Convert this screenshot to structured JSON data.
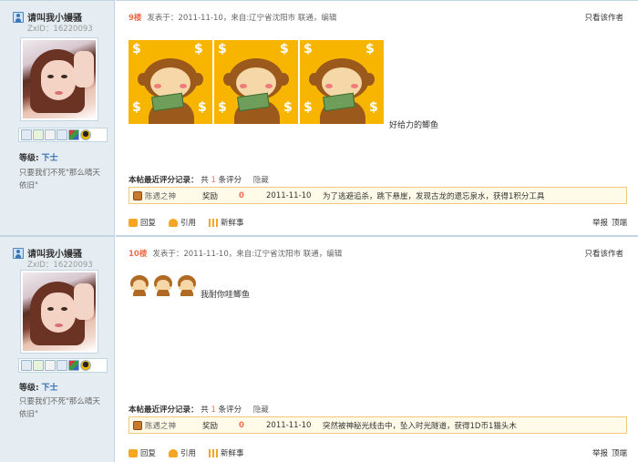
{
  "posts": [
    {
      "user": {
        "name": "请叫我小嫚骚",
        "uid": "ZxID：16220093",
        "rank_label": "等级:",
        "rank_value": "下士",
        "signature": "只要我们不死\"那么晴天依旧\""
      },
      "floor": "9楼",
      "posted": "发表于：2011-11-10，来自:辽宁省沈阳市 联通，编辑",
      "only_author": "只看该作者",
      "emoji_count": 3,
      "text": "好给力的鲫鱼",
      "rating": {
        "title": "本帖最近评分记录：",
        "count_prefix": "共",
        "count": "1",
        "count_suffix": "条评分",
        "hide": "隐藏",
        "rater": "陈遇之神",
        "type": "奖励",
        "score": "0",
        "date": "2011-11-10",
        "reason": "为了逃避追杀，跳下悬崖，发现古龙的遗忘泉水，获得1积分工具"
      },
      "actions": {
        "reply": "回复",
        "quote": "引用",
        "fresh": "新鲜事"
      },
      "report": {
        "report": "举报",
        "top": "顶端"
      }
    },
    {
      "user": {
        "name": "请叫我小嫚骚",
        "uid": "ZxID：16220093",
        "rank_label": "等级:",
        "rank_value": "下士",
        "signature": "只要我们不死\"那么晴天依旧\""
      },
      "floor": "10楼",
      "posted": "发表于：2011-11-10，来自:辽宁省沈阳市 联通，编辑",
      "only_author": "只看该作者",
      "emoji_count": 3,
      "text": "我耐你哇鲫鱼",
      "rating": {
        "title": "本帖最近评分记录：",
        "count_prefix": "共",
        "count": "1",
        "count_suffix": "条评分",
        "hide": "隐藏",
        "rater": "陈遇之神",
        "type": "奖励",
        "score": "0",
        "date": "2011-11-10",
        "reason": "突然被神秘光线击中，坠入时光隧道，获得1D币1猫头木"
      },
      "actions": {
        "reply": "回复",
        "quote": "引用",
        "fresh": "新鲜事"
      },
      "report": {
        "report": "举报",
        "top": "顶端"
      }
    }
  ],
  "colors": {
    "sidebar": "#e5edf2",
    "border": "#c2d5e3",
    "accent": "#f26c4f",
    "rating_bg": "#fffbe8",
    "rating_border": "#f0c97b"
  }
}
